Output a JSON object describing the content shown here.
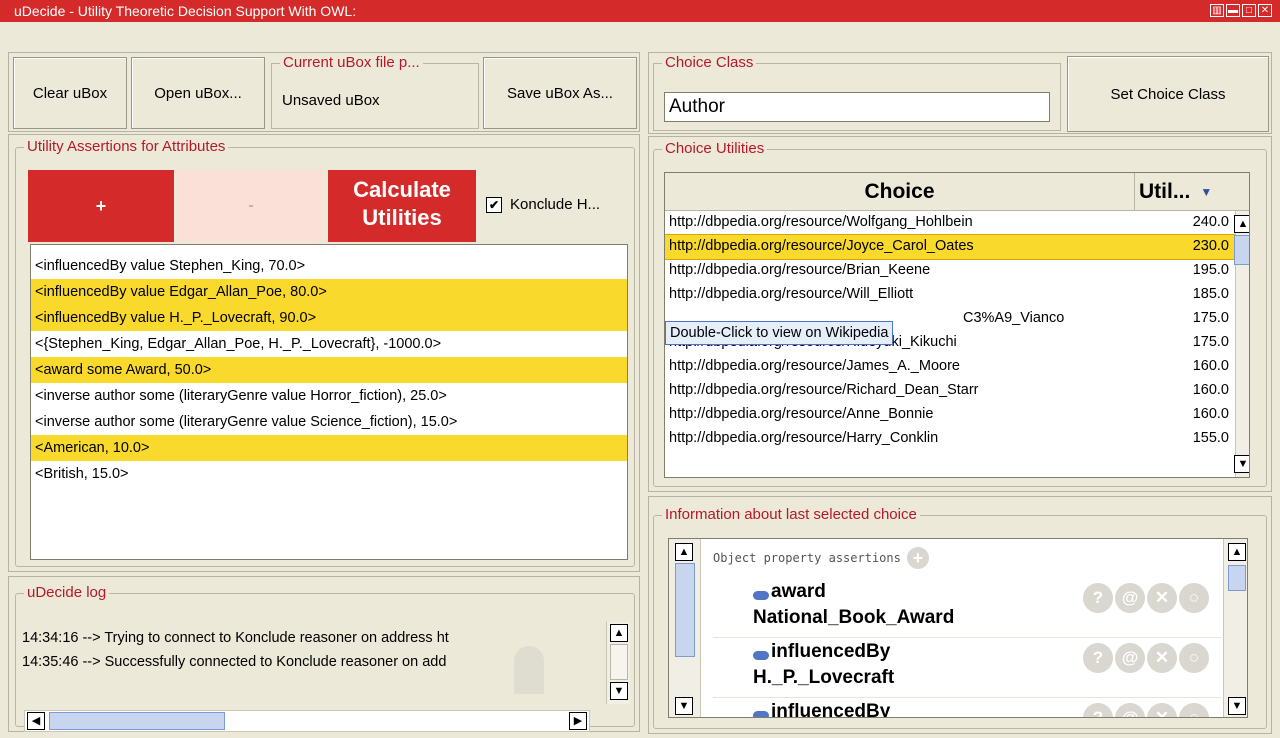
{
  "window": {
    "title": "uDecide - Utility Theoretic Decision Support With OWL:"
  },
  "toolbar": {
    "clear_label": "Clear uBox",
    "open_label": "Open uBox...",
    "current_file_legend": "Current uBox file p...",
    "current_file_value": "Unsaved uBox",
    "save_label": "Save uBox As..."
  },
  "choice_class": {
    "legend": "Choice Class",
    "value": "Author",
    "set_label": "Set Choice Class"
  },
  "utility_assertions": {
    "legend": "Utility Assertions for Attributes",
    "add_label": "+",
    "remove_label": "-",
    "calculate_label_1": "Calculate",
    "calculate_label_2": "Utilities",
    "konclude_label": "Konclude H...",
    "konclude_checked": true,
    "items": [
      {
        "text": "<influencedBy value Stephen_King, 70.0>",
        "highlighted": false
      },
      {
        "text": "<influencedBy value Edgar_Allan_Poe, 80.0>",
        "highlighted": true
      },
      {
        "text": "<influencedBy value H._P._Lovecraft, 90.0>",
        "highlighted": true
      },
      {
        "text": "<{Stephen_King, Edgar_Allan_Poe, H._P._Lovecraft}, -1000.0>",
        "highlighted": false
      },
      {
        "text": "<award some Award, 50.0>",
        "highlighted": true
      },
      {
        "text": "<inverse author some (literaryGenre value Horror_fiction), 25.0>",
        "highlighted": false
      },
      {
        "text": "<inverse author some (literaryGenre value Science_fiction), 15.0>",
        "highlighted": false
      },
      {
        "text": "<American, 10.0>",
        "highlighted": true
      },
      {
        "text": "<British, 15.0>",
        "highlighted": false
      }
    ]
  },
  "choice_utilities": {
    "legend": "Choice Utilities",
    "col_choice": "Choice",
    "col_util": "Util...",
    "tooltip": "Double-Click to view on Wikipedia",
    "rows": [
      {
        "choice": "http://dbpedia.org/resource/Wolfgang_Hohlbein",
        "util": "240.0"
      },
      {
        "choice": "http://dbpedia.org/resource/Joyce_Carol_Oates",
        "util": "230.0"
      },
      {
        "choice": "http://dbpedia.org/resource/Brian_Keene",
        "util": "195.0"
      },
      {
        "choice": "http://dbpedia.org/resource/Will_Elliott",
        "util": "185.0"
      },
      {
        "choice": "C3%A9_Vianco",
        "util": "175.0"
      },
      {
        "choice": "http://dbpedia.org/resource/Hideyuki_Kikuchi",
        "util": "175.0"
      },
      {
        "choice": "http://dbpedia.org/resource/James_A._Moore",
        "util": "160.0"
      },
      {
        "choice": "http://dbpedia.org/resource/Richard_Dean_Starr",
        "util": "160.0"
      },
      {
        "choice": "http://dbpedia.org/resource/Anne_Bonnie",
        "util": "160.0"
      },
      {
        "choice": "http://dbpedia.org/resource/Harry_Conklin",
        "util": "155.0"
      }
    ]
  },
  "log": {
    "legend": "uDecide log",
    "lines": [
      "14:34:16 --> Trying to connect to Konclude reasoner on address ht",
      "14:35:46 --> Successfully connected to Konclude reasoner on add"
    ]
  },
  "info": {
    "legend": "Information about last selected choice",
    "section_label": "Object property assertions",
    "entries": [
      {
        "prop": "award",
        "value": "National_Book_Award"
      },
      {
        "prop": "influencedBy",
        "value": "H._P._Lovecraft"
      },
      {
        "prop": "influencedBy",
        "value": ""
      }
    ]
  },
  "colors": {
    "accent": "#d52a2a",
    "highlight": "#f8d92c",
    "legend": "#b4192a"
  }
}
